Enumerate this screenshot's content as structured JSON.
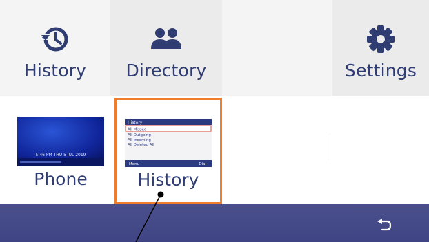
{
  "topbar": {
    "items": [
      {
        "label": "History",
        "icon": "history-icon"
      },
      {
        "label": "Directory",
        "icon": "people-icon"
      },
      {
        "label": "",
        "icon": ""
      },
      {
        "label": "Settings",
        "icon": "gear-icon"
      }
    ]
  },
  "apps": [
    {
      "label": "Phone",
      "thumb_text": "5:46 PM THU  5 JUL 2019"
    },
    {
      "label": "History",
      "thumb": {
        "header": "History",
        "items": [
          "All Missed",
          "All Outgoing",
          "All Incoming",
          "All Deleted All"
        ],
        "footer_left": "Menu",
        "footer_right": "Dial"
      }
    }
  ],
  "colors": {
    "accent": "#2f3d73",
    "selection": "#f07d2c",
    "bottombar": "#434983"
  }
}
